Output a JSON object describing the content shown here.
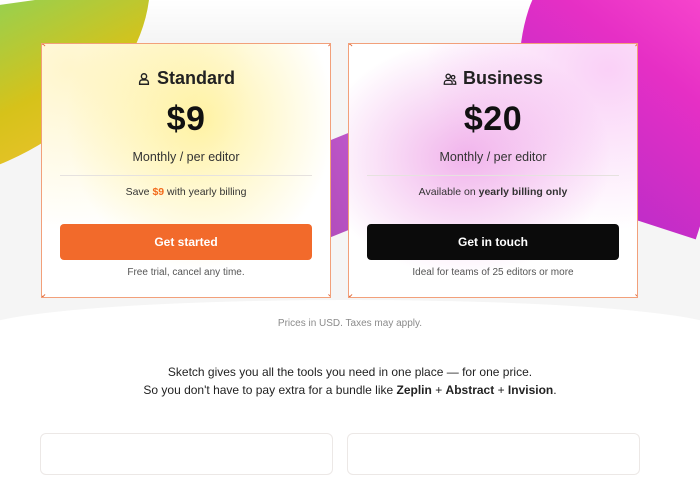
{
  "plans": [
    {
      "name": "Standard",
      "icon": "user-icon",
      "price": "$9",
      "period": "Monthly / per editor",
      "billing": {
        "pre": "Save ",
        "highlight": "$9",
        "post": " with yearly billing"
      },
      "cta": "Get started",
      "note": "Free trial, cancel any time."
    },
    {
      "name": "Business",
      "icon": "users-icon",
      "price": "$20",
      "period": "Monthly / per editor",
      "billing": {
        "pre": "Available on ",
        "highlight": "yearly billing only",
        "post": ""
      },
      "cta": "Get in touch",
      "note": "Ideal for teams of 25 editors or more"
    }
  ],
  "prices_note": "Prices in USD. Taxes may apply.",
  "pitch": {
    "line1": "Sketch gives you all the tools you need in one place — for one price.",
    "line2_pre": "So you don't have to pay extra for a bundle like ",
    "zeplin": "Zeplin",
    "plus1": " + ",
    "abstract": "Abstract",
    "plus2": " + ",
    "invision": "Invision",
    "end": "."
  },
  "colors": {
    "accent": "#f26a2b",
    "dark_button": "#0b0b0b",
    "card_border": "#f2a07a"
  }
}
